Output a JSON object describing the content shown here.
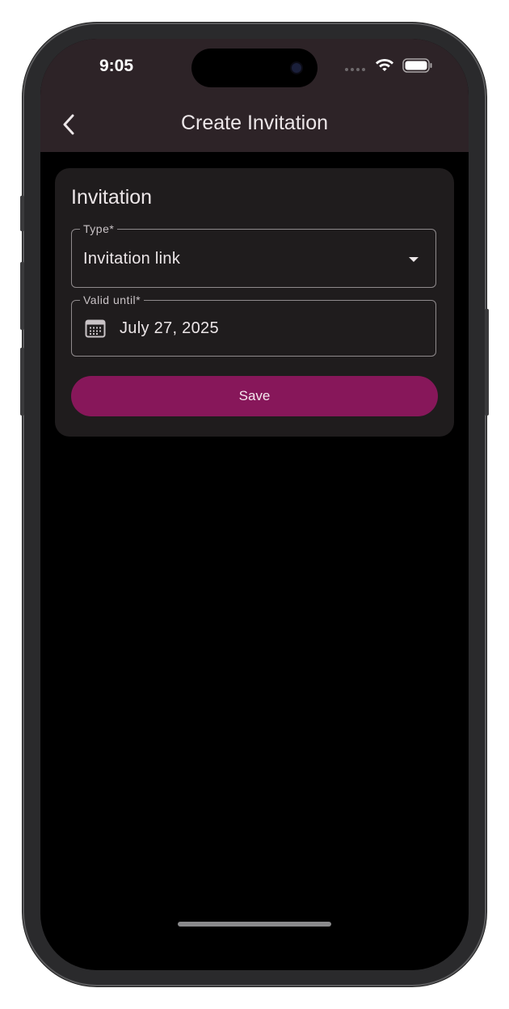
{
  "status_bar": {
    "time": "9:05"
  },
  "app_bar": {
    "back_icon": "chevron-left-icon",
    "title": "Create Invitation"
  },
  "card": {
    "title": "Invitation",
    "type_field": {
      "label": "Type*",
      "value": "Invitation link",
      "icon": "dropdown-arrow-icon"
    },
    "valid_until_field": {
      "label": "Valid until*",
      "value": "July 27, 2025",
      "icon": "calendar-icon"
    },
    "save_label": "Save"
  },
  "colors": {
    "app_bar": "#2d2327",
    "background": "#000000",
    "card": "#1f1c1d",
    "primary_button": "#87175a",
    "field_border": "#8f8a8c",
    "text": "#ece6e8"
  }
}
